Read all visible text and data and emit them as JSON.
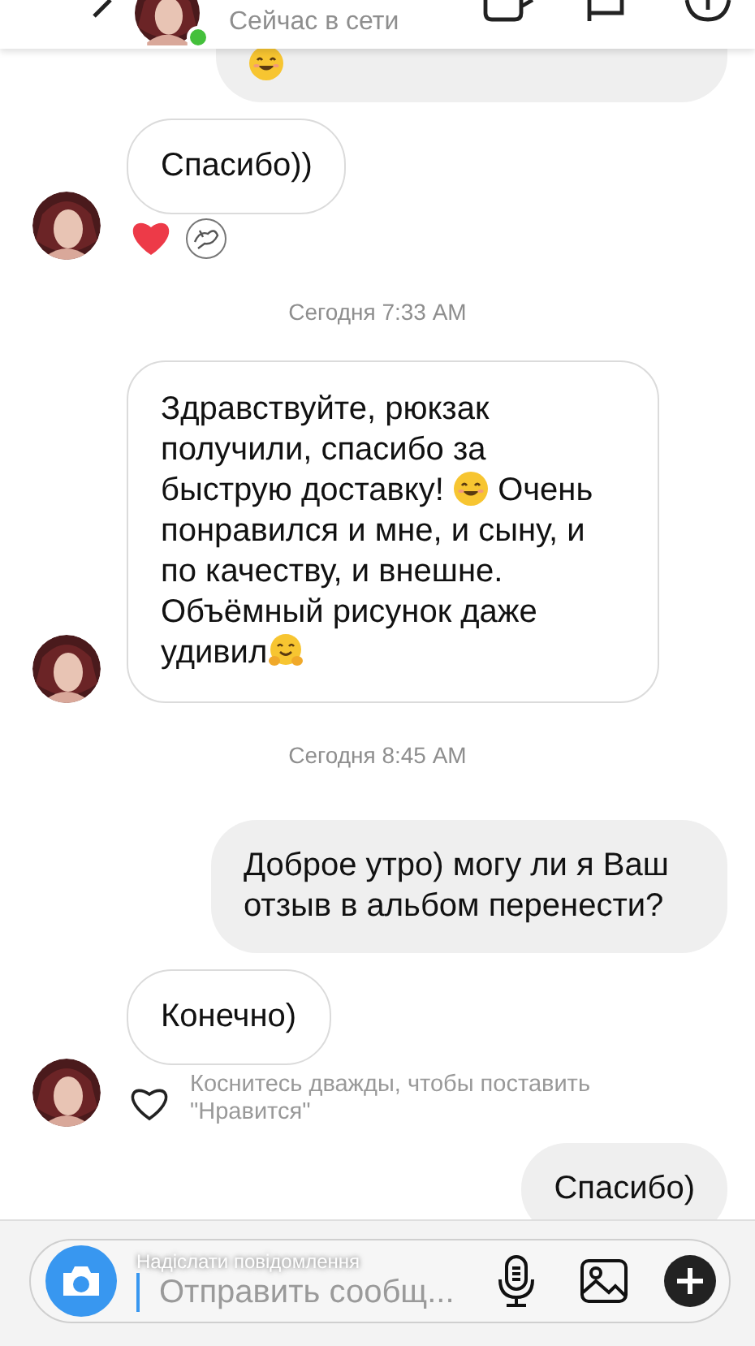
{
  "header": {
    "status": "Сейчас в сети",
    "online": true
  },
  "thread": [
    {
      "kind": "sent",
      "segments": [
        {
          "kind": "smile"
        }
      ]
    },
    {
      "kind": "received",
      "segments": [
        {
          "kind": "text",
          "text": "Спасибо))"
        }
      ],
      "reactions": [
        {
          "kind": "heart"
        },
        {
          "kind": "sticker"
        }
      ]
    },
    {
      "kind": "time",
      "text": "Сегодня 7:33 AM"
    },
    {
      "kind": "received",
      "segments": [
        {
          "kind": "text",
          "text": "Здравствуйте, рюкзак получили, спасибо за быструю доставку! "
        },
        {
          "kind": "smile"
        },
        {
          "kind": "text",
          "text": " Очень понравился и мне, и сыну, и по качеству, и внешне. Объёмный рисунок даже удивил"
        },
        {
          "kind": "hug"
        }
      ]
    },
    {
      "kind": "time",
      "text": "Сегодня 8:45 AM"
    },
    {
      "kind": "sent",
      "segments": [
        {
          "kind": "text",
          "text": "Доброе утро) могу ли я Ваш отзыв в альбом перенести?"
        }
      ]
    },
    {
      "kind": "received",
      "segments": [
        {
          "kind": "text",
          "text": "Конечно)"
        }
      ],
      "like_hint": {
        "liked": false,
        "text": "Коснитесь дважды, чтобы поставить \"Нравится\""
      }
    },
    {
      "kind": "sent",
      "segments": [
        {
          "kind": "text",
          "text": "Спасибо)"
        }
      ]
    }
  ],
  "composer": {
    "placeholder": "Отправить сообщ...",
    "overlay_hint": "Надіслати повідомлення"
  }
}
